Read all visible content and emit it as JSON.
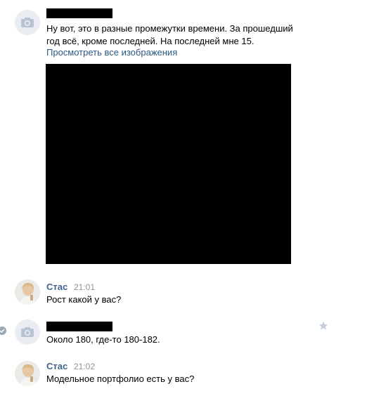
{
  "messages": [
    {
      "text_lines": [
        "Ну вот, это в разные промежутки времени. За прошедший",
        "год всё, кроме последней. На последней мне 15."
      ],
      "link": "Просмотреть все изображения"
    },
    {
      "author": "Стас",
      "time": "21:01",
      "text": "Рост какой у вас?"
    },
    {
      "text": "Около 180, где-то 180-182."
    },
    {
      "author": "Стас",
      "time": "21:02",
      "text": "Модельное портфолио есть у вас?"
    }
  ],
  "icons": {
    "camera": "camera-icon",
    "check": "check-icon",
    "star": "star-icon"
  },
  "colors": {
    "author_name": "#42648b",
    "link": "#2a5885",
    "timestamp": "#939393",
    "star": "#c5d0db",
    "check": "#9aa7b6"
  }
}
